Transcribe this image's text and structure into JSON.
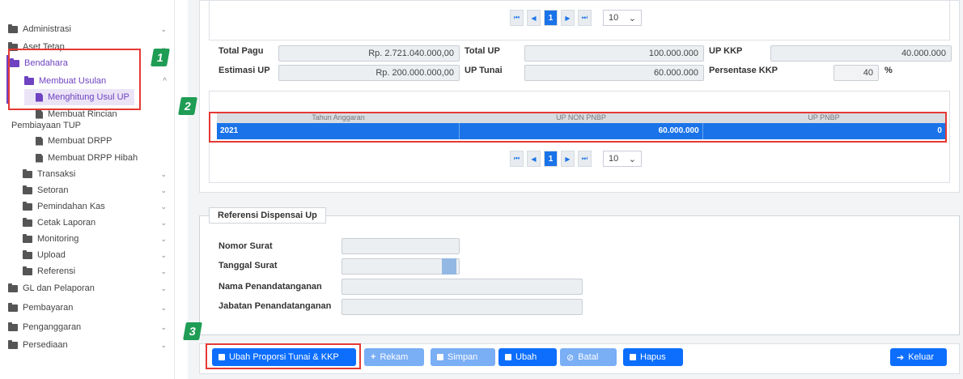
{
  "sidebar": {
    "items": [
      {
        "label": "Administrasi"
      },
      {
        "label": "Aset Tetap"
      },
      {
        "label": "Bendahara"
      },
      {
        "label": "Membuat Usulan"
      },
      {
        "label": "Menghitung Usul UP"
      },
      {
        "label": "Membuat Rincian"
      },
      {
        "label": "Pembiayaan TUP"
      },
      {
        "label": "Membuat DRPP"
      },
      {
        "label": "Membuat DRPP Hibah"
      },
      {
        "label": "Transaksi"
      },
      {
        "label": "Setoran"
      },
      {
        "label": "Pemindahan Kas"
      },
      {
        "label": "Cetak Laporan"
      },
      {
        "label": "Monitoring"
      },
      {
        "label": "Upload"
      },
      {
        "label": "Referensi"
      },
      {
        "label": "GL dan Pelaporan"
      },
      {
        "label": "Pembayaran"
      },
      {
        "label": "Penganggaran"
      },
      {
        "label": "Persediaan"
      }
    ]
  },
  "pager": {
    "first": "⏮",
    "prev": "◀",
    "page": "1",
    "next": "▶",
    "last": "⏭",
    "size": "10",
    "caret": "⌄"
  },
  "summary": {
    "total_pagu_label": "Total Pagu",
    "total_pagu": "Rp. 2.721.040.000,00",
    "total_up_label": "Total UP",
    "total_up": "100.000.000",
    "up_kkp_label": "UP KKP",
    "up_kkp": "40.000.000",
    "estimasi_up_label": "Estimasi UP",
    "estimasi_up": "Rp. 200.000.000,00",
    "up_tunai_label": "UP Tunai",
    "up_tunai": "60.000.000",
    "persentase_kkp_label": "Persentase KKP",
    "persentase_kkp": "40",
    "percent_sign": "%"
  },
  "table": {
    "headers": [
      "Tahun Anggaran",
      "UP NON PNBP",
      "UP PNBP"
    ],
    "rows": [
      [
        "2021",
        "60.000.000",
        "0"
      ]
    ]
  },
  "dispensasi": {
    "legend": "Referensi Dispensai Up",
    "nomor_surat": "Nomor Surat",
    "tanggal_surat": "Tanggal Surat",
    "nama_penandatangan": "Nama Penandatanganan",
    "jabatan_penandatangan": "Jabatan Penandatanganan"
  },
  "buttons": {
    "ubah_proporsi": "Ubah Proporsi Tunai & KKP",
    "rekam": "Rekam",
    "simpan": "Simpan",
    "ubah": "Ubah",
    "batal": "Batal",
    "hapus": "Hapus",
    "keluar": "Keluar"
  },
  "annotations": {
    "step1": "1",
    "step2": "2",
    "step3": "3"
  },
  "colors": {
    "accent": "#1a73e8",
    "active_menu": "#6f42c1",
    "highlight": "#e53935",
    "badge": "#1f9d55"
  }
}
